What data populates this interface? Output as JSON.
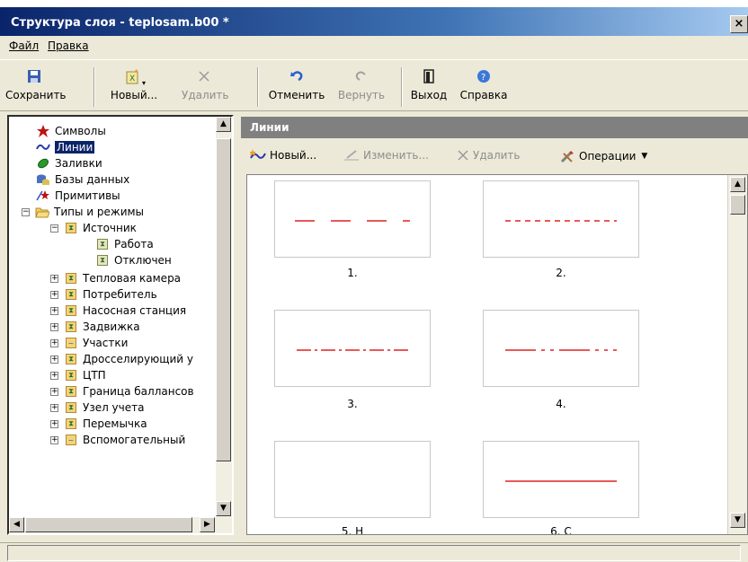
{
  "window": {
    "title": "Структура слоя - teplosam.b00 *",
    "close_glyph": "×"
  },
  "menu": {
    "items": [
      "Файл",
      "Правка"
    ]
  },
  "toolbar": {
    "save": "Сохранить",
    "new": "Новый...",
    "delete": "Удалить",
    "undo": "Отменить",
    "redo": "Вернуть",
    "exit": "Выход",
    "help": "Справка"
  },
  "tree": {
    "items": [
      {
        "label": "Символы",
        "icon": "star-icon"
      },
      {
        "label": "Линии",
        "icon": "line-wave-icon",
        "selected": true
      },
      {
        "label": "Заливки",
        "icon": "fill-icon"
      },
      {
        "label": "Базы данных",
        "icon": "database-icon"
      },
      {
        "label": "Примитивы",
        "icon": "primitives-icon"
      },
      {
        "label": "Типы и режимы",
        "icon": "folder-open-icon"
      },
      {
        "label": "Источник"
      },
      {
        "label": "Работа"
      },
      {
        "label": "Отключен"
      },
      {
        "label": "Тепловая камера"
      },
      {
        "label": "Потребитель"
      },
      {
        "label": "Насосная станция"
      },
      {
        "label": "Задвижка"
      },
      {
        "label": "Участки"
      },
      {
        "label": "Дросселирующий у"
      },
      {
        "label": "ЦТП"
      },
      {
        "label": "Граница баллансов"
      },
      {
        "label": "Узел учета"
      },
      {
        "label": "Перемычка"
      },
      {
        "label": "Вспомогательный"
      }
    ]
  },
  "panel": {
    "title": "Линии",
    "toolbar": {
      "new": "Новый...",
      "edit": "Изменить...",
      "delete": "Удалить",
      "ops": "Операции"
    }
  },
  "lines": [
    {
      "label": "1.",
      "style": "long-dash"
    },
    {
      "label": "2.",
      "style": "short-dash"
    },
    {
      "label": "3.",
      "style": "dash-dot"
    },
    {
      "label": "4.",
      "style": "long-dot-dot"
    },
    {
      "label": "5. Н",
      "style": "none"
    },
    {
      "label": "6. С",
      "style": "solid"
    }
  ],
  "colors": {
    "line_red": "#e02020",
    "titlebar_dark": "#0a246a",
    "panel_header": "#808080"
  }
}
